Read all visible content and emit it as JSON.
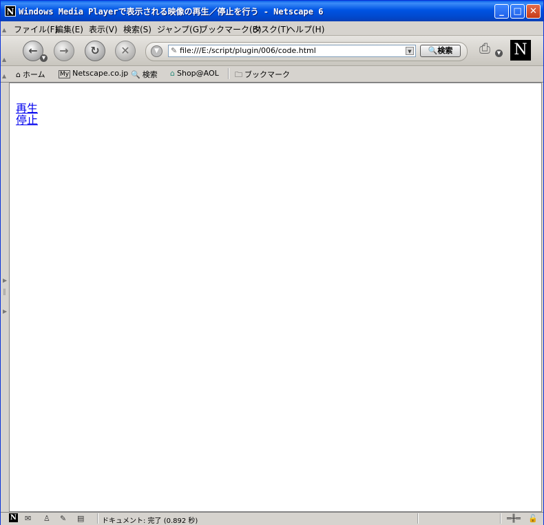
{
  "window": {
    "title": "Windows Media Playerで表示される映像の再生／停止を行う - Netscape 6",
    "app_icon": "N",
    "minimize": "_",
    "maximize": "□",
    "close": "✕"
  },
  "menu": {
    "items": [
      {
        "label": "ファイル(F)"
      },
      {
        "label": "編集(E)"
      },
      {
        "label": "表示(V)"
      },
      {
        "label": "検索(S)"
      },
      {
        "label": "ジャンプ(G)"
      },
      {
        "label": "ブックマーク(B)"
      },
      {
        "label": "タスク(T)"
      },
      {
        "label": "ヘルプ(H)"
      }
    ]
  },
  "nav": {
    "back_icon": "←",
    "forward_icon": "→",
    "reload_icon": "↻",
    "stop_icon": "✕",
    "url": "file:///E:/script/plugin/006/code.html",
    "search_label": "検索",
    "logo_text": "N"
  },
  "personal_toolbar": {
    "items": [
      {
        "label": "ホーム",
        "icon": "home-icon"
      },
      {
        "label": "Netscape.co.jp",
        "icon": "my-netscape-icon"
      },
      {
        "label": "検索",
        "icon": "search-icon"
      },
      {
        "label": "Shop@AOL",
        "icon": "shop-icon"
      },
      {
        "label": "ブックマーク",
        "icon": "folder-icon"
      }
    ]
  },
  "content": {
    "links": [
      {
        "label": "再生"
      },
      {
        "label": "停止"
      }
    ]
  },
  "status": {
    "text": "ドキュメント: 完了 (0.892 秒)"
  },
  "colors": {
    "titlebar": "#0054e3",
    "link": "#0000ee",
    "chrome": "#d6d3ce"
  }
}
